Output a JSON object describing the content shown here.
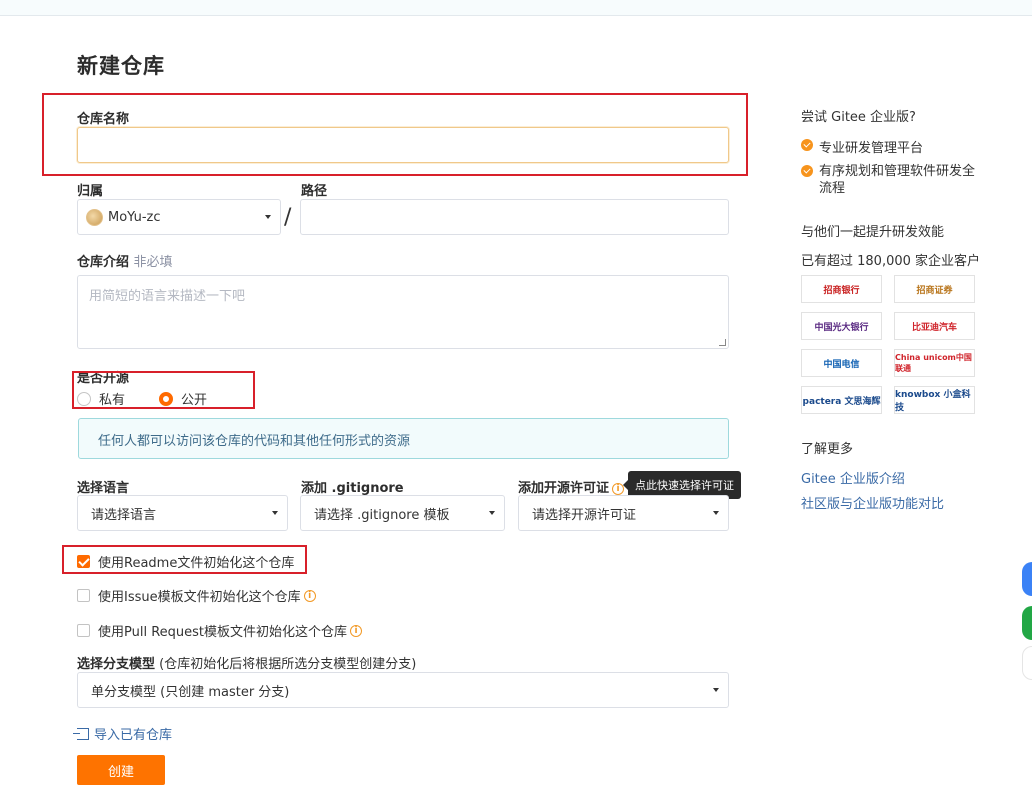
{
  "page_title": "新建仓库",
  "repo_name": {
    "label": "仓库名称",
    "value": ""
  },
  "owner": {
    "label": "归属",
    "value": "MoYu-zc"
  },
  "path": {
    "label": "路径",
    "separator": "/",
    "value": ""
  },
  "intro": {
    "label": "仓库介绍",
    "optional": "非必填",
    "placeholder": "用简短的语言来描述一下吧"
  },
  "visibility": {
    "label": "是否开源",
    "options": [
      {
        "label": "私有",
        "selected": false
      },
      {
        "label": "公开",
        "selected": true
      }
    ],
    "notice": "任何人都可以访问该仓库的代码和其他任何形式的资源"
  },
  "language": {
    "label": "选择语言",
    "value": "请选择语言"
  },
  "gitignore": {
    "label": "添加 .gitignore",
    "value": "请选择 .gitignore 模板"
  },
  "license": {
    "label": "添加开源许可证",
    "value": "请选择开源许可证",
    "tooltip": "点此快速选择许可证"
  },
  "init_options": [
    {
      "label": "使用Readme文件初始化这个仓库",
      "checked": true,
      "info": false
    },
    {
      "label": "使用Issue模板文件初始化这个仓库",
      "checked": false,
      "info": true
    },
    {
      "label": "使用Pull Request模板文件初始化这个仓库",
      "checked": false,
      "info": true
    }
  ],
  "branch_model": {
    "label": "选择分支模型",
    "hint": "(仓库初始化后将根据所选分支模型创建分支)",
    "value": "单分支模型 (只创建 master 分支)"
  },
  "import_link": "导入已有仓库",
  "create_button": "创建",
  "sidebar": {
    "try_title": "尝试 Gitee 企业版?",
    "features": [
      "专业研发管理平台",
      "有序规划和管理软件研发全流程"
    ],
    "together": "与他们一起提升研发效能",
    "customers": "已有超过 180,000 家企业客户",
    "logos": [
      "招商银行",
      "招商证券",
      "中国光大银行",
      "比亚迪汽车",
      "中国电信",
      "China unicom中国联通",
      "pactera 文思海辉",
      "knowbox 小盒科技"
    ],
    "more_title": "了解更多",
    "links": [
      "Gitee 企业版介绍",
      "社区版与企业版功能对比"
    ]
  },
  "colors": {
    "accent": "#fe7300",
    "highlight_box": "#d8202a",
    "link": "#3a6aa6"
  }
}
